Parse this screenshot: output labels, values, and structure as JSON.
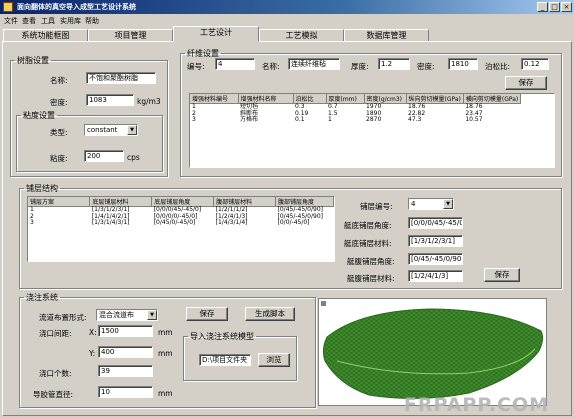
{
  "window": {
    "title": "面向翻体的真空导入成型工艺设计系统",
    "min_glyph": "_",
    "max_glyph": "□",
    "close_glyph": "×"
  },
  "menu": [
    "文件",
    "查看",
    "工具",
    "实用库",
    "帮助"
  ],
  "tabs": [
    "系统功能框图",
    "项目管理",
    "工艺设计",
    "工艺模拟",
    "数据库管理"
  ],
  "resin": {
    "group_label": "树脂设置",
    "name_label": "名称:",
    "name_value": "不饱和聚酯树脂",
    "density_label": "密度:",
    "density_value": "1083",
    "density_unit": "kg/m3",
    "viscosity_group_label": "粘度设置",
    "type_label": "类型:",
    "type_value": "constant",
    "viscosity_label": "粘度:",
    "viscosity_value": "200",
    "viscosity_unit": "cps"
  },
  "fiber": {
    "group_label": "纤维设置",
    "id_label": "编号:",
    "id_value": "4",
    "name_label": "名称:",
    "name_value": "连续纤维毡",
    "thickness_label": "厚度:",
    "thickness_value": "1.2",
    "density_label": "密度:",
    "density_value": "1810",
    "poisson_label": "泊松比:",
    "poisson_value": "0.12",
    "save_label": "保存",
    "columns": [
      "增强材料编号",
      "增强材料名称",
      "泊松比",
      "厚度(mm)",
      "密度(g/cm3)",
      "纵向剪切模量(GPa)",
      "横向剪切模量(GPa)"
    ],
    "rows": [
      [
        "1",
        "短切毡",
        "0.3",
        "0.7",
        "1970",
        "18.76",
        "18.76"
      ],
      [
        "2",
        "斜断布",
        "0.19",
        "1.5",
        "1890",
        "22.82",
        "23.47"
      ],
      [
        "3",
        "方格布",
        "0.1",
        "1",
        "2870",
        "47.3",
        "10.57"
      ]
    ]
  },
  "ply": {
    "group_label": "铺层结构",
    "columns": [
      "铺层方案",
      "底层铺层材料",
      "底层铺层角度",
      "腹部铺层材料",
      "腹部铺层角度"
    ],
    "rows": [
      [
        "1",
        "[1/3/1/2/3/1]",
        "[0/0/0/45/-45/0]",
        "[1/2/1/1/2]",
        "[0/45/-45/0/90]"
      ],
      [
        "2",
        "[1/4/1/4/2/1]",
        "[0/0/0/0/-45/0]",
        "[1/2/4/1/3]",
        "[0/45/-45/0/90]"
      ],
      [
        "3",
        "[1/3/1/4/3/1]",
        "[0/45/0/-45/0]",
        "[1/4/3/1/4]",
        "[0/0/-45/0]"
      ]
    ],
    "id_label": "铺层编号:",
    "id_value": "4",
    "bottom_angle_label": "艇底铺层角度:",
    "bottom_angle_value": "[0/0/0/45/-45/0]",
    "bottom_material_label": "艇底铺层材料:",
    "bottom_material_value": "[1/3/1/2/3/1]",
    "belly_angle_label": "艇腹铺层角度:",
    "belly_angle_value": "[0/45/-45/0/90]",
    "belly_material_label": "艇腹铺层材料:",
    "belly_material_value": "[1/2/4/1/3]",
    "save_label": "保存"
  },
  "flow": {
    "group_label": "浇注系统",
    "channel_label": "流道布置形式:",
    "channel_value": "混合流道布",
    "gate_spacing_label": "浇口间距:",
    "x_label": "X:",
    "x_value": "1500",
    "y_label": "Y:",
    "y_value": "400",
    "unit_mm": "mm",
    "gate_count_label": "浇口个数:",
    "gate_count_value": "39",
    "tube_diameter_label": "导胶管直径:",
    "tube_diameter_value": "10",
    "save_label": "保存",
    "gen_script_label": "生成脚本",
    "import_label": "导入浇注系统模型",
    "path_value": "D:\\项目文件夹",
    "browse_label": "浏览"
  },
  "watermark": "FRPAPP.COM",
  "colors": {
    "title_bar": "#0a246a",
    "mesh_green": "#3f8a2c",
    "face": "#d4d0c8"
  }
}
